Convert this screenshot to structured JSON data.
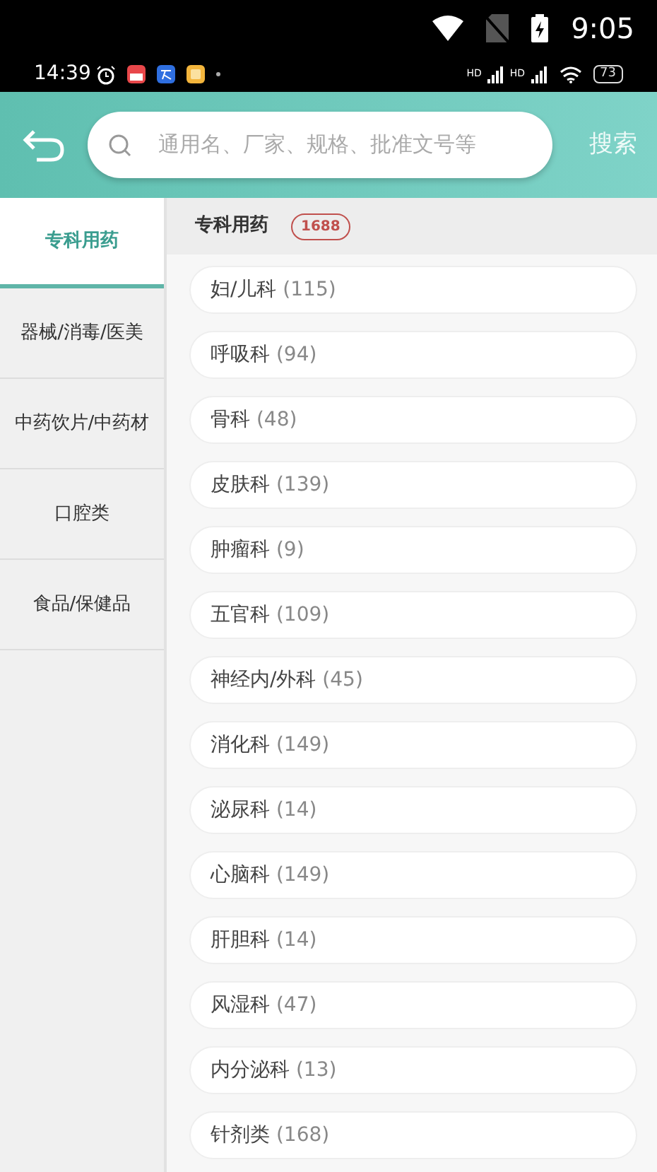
{
  "system_bar": {
    "time": "9:05"
  },
  "phone_status_bar": {
    "time": "14:39",
    "signal_labels": [
      "HD",
      "HD"
    ],
    "battery": "73"
  },
  "header": {
    "search": {
      "placeholder": "通用名、厂家、规格、批准文号等"
    },
    "search_button": "搜索"
  },
  "sidebar": {
    "items": [
      {
        "label": "专科用药",
        "selected": true
      },
      {
        "label": "器械/消毒/医美",
        "selected": false
      },
      {
        "label": "中药饮片/中药材",
        "selected": false
      },
      {
        "label": "口腔类",
        "selected": false
      },
      {
        "label": "食品/保健品",
        "selected": false
      }
    ]
  },
  "content": {
    "title": "专科用药",
    "count": "1688",
    "items": [
      {
        "name": "妇/儿科",
        "count": "(115)"
      },
      {
        "name": "呼吸科",
        "count": "(94)"
      },
      {
        "name": "骨科",
        "count": "(48)"
      },
      {
        "name": "皮肤科",
        "count": "(139)"
      },
      {
        "name": "肿瘤科",
        "count": "(9)"
      },
      {
        "name": "五官科",
        "count": "(109)"
      },
      {
        "name": "神经内/外科",
        "count": "(45)"
      },
      {
        "name": "消化科",
        "count": "(149)"
      },
      {
        "name": "泌尿科",
        "count": "(14)"
      },
      {
        "name": "心脑科",
        "count": "(149)"
      },
      {
        "name": "肝胆科",
        "count": "(14)"
      },
      {
        "name": "风湿科",
        "count": "(47)"
      },
      {
        "name": "内分泌科",
        "count": "(13)"
      },
      {
        "name": "针剂类",
        "count": "(168)"
      }
    ]
  }
}
